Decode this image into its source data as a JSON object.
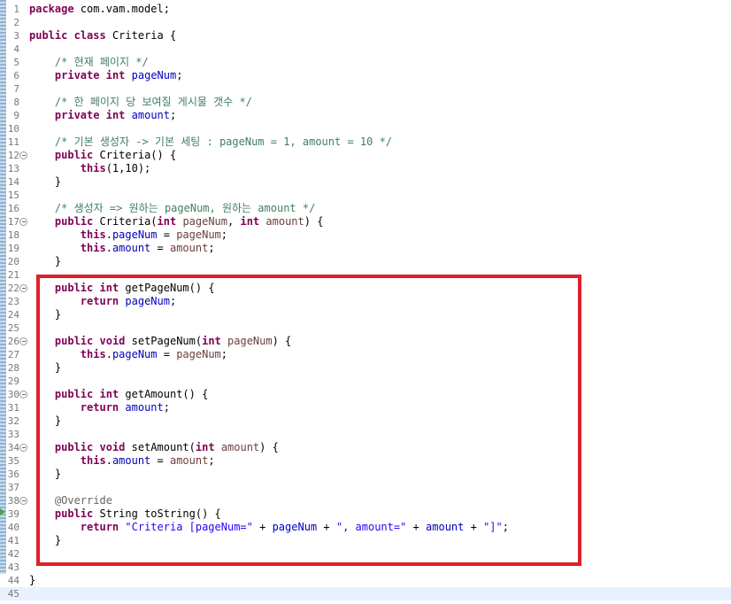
{
  "editor": {
    "lines": [
      {
        "n": "1",
        "tokens": [
          {
            "c": "kw",
            "t": "package"
          },
          {
            "c": "plain",
            "t": " com.vam.model;"
          }
        ]
      },
      {
        "n": "2",
        "tokens": []
      },
      {
        "n": "3",
        "tokens": [
          {
            "c": "kw",
            "t": "public"
          },
          {
            "c": "plain",
            "t": " "
          },
          {
            "c": "kw",
            "t": "class"
          },
          {
            "c": "plain",
            "t": " Criteria {"
          }
        ]
      },
      {
        "n": "4",
        "tokens": []
      },
      {
        "n": "5",
        "tokens": [
          {
            "c": "plain",
            "t": "    "
          },
          {
            "c": "comment",
            "t": "/* 현재 페이지 */"
          }
        ]
      },
      {
        "n": "6",
        "tokens": [
          {
            "c": "plain",
            "t": "    "
          },
          {
            "c": "kw",
            "t": "private"
          },
          {
            "c": "plain",
            "t": " "
          },
          {
            "c": "kw",
            "t": "int"
          },
          {
            "c": "plain",
            "t": " "
          },
          {
            "c": "field",
            "t": "pageNum"
          },
          {
            "c": "plain",
            "t": ";"
          }
        ]
      },
      {
        "n": "7",
        "tokens": []
      },
      {
        "n": "8",
        "tokens": [
          {
            "c": "plain",
            "t": "    "
          },
          {
            "c": "comment",
            "t": "/* 한 페이지 당 보여질 게시물 갯수 */"
          }
        ]
      },
      {
        "n": "9",
        "tokens": [
          {
            "c": "plain",
            "t": "    "
          },
          {
            "c": "kw",
            "t": "private"
          },
          {
            "c": "plain",
            "t": " "
          },
          {
            "c": "kw",
            "t": "int"
          },
          {
            "c": "plain",
            "t": " "
          },
          {
            "c": "field",
            "t": "amount"
          },
          {
            "c": "plain",
            "t": ";"
          }
        ]
      },
      {
        "n": "10",
        "tokens": []
      },
      {
        "n": "11",
        "tokens": [
          {
            "c": "plain",
            "t": "    "
          },
          {
            "c": "comment",
            "t": "/* 기본 생성자 -> 기본 세팅 : pageNum = 1, amount = 10 */"
          }
        ]
      },
      {
        "n": "12",
        "fold": true,
        "tokens": [
          {
            "c": "plain",
            "t": "    "
          },
          {
            "c": "kw",
            "t": "public"
          },
          {
            "c": "plain",
            "t": " Criteria() {"
          }
        ]
      },
      {
        "n": "13",
        "tokens": [
          {
            "c": "plain",
            "t": "        "
          },
          {
            "c": "kw",
            "t": "this"
          },
          {
            "c": "plain",
            "t": "(1,10);"
          }
        ]
      },
      {
        "n": "14",
        "tokens": [
          {
            "c": "plain",
            "t": "    }"
          }
        ]
      },
      {
        "n": "15",
        "tokens": []
      },
      {
        "n": "16",
        "tokens": [
          {
            "c": "plain",
            "t": "    "
          },
          {
            "c": "comment",
            "t": "/* 생성자 => 원하는 pageNum, 원하는 amount */"
          }
        ]
      },
      {
        "n": "17",
        "fold": true,
        "tokens": [
          {
            "c": "plain",
            "t": "    "
          },
          {
            "c": "kw",
            "t": "public"
          },
          {
            "c": "plain",
            "t": " Criteria("
          },
          {
            "c": "kw",
            "t": "int"
          },
          {
            "c": "plain",
            "t": " "
          },
          {
            "c": "param",
            "t": "pageNum"
          },
          {
            "c": "plain",
            "t": ", "
          },
          {
            "c": "kw",
            "t": "int"
          },
          {
            "c": "plain",
            "t": " "
          },
          {
            "c": "param",
            "t": "amount"
          },
          {
            "c": "plain",
            "t": ") {"
          }
        ]
      },
      {
        "n": "18",
        "tokens": [
          {
            "c": "plain",
            "t": "        "
          },
          {
            "c": "kw",
            "t": "this"
          },
          {
            "c": "plain",
            "t": "."
          },
          {
            "c": "field",
            "t": "pageNum"
          },
          {
            "c": "plain",
            "t": " = "
          },
          {
            "c": "param",
            "t": "pageNum"
          },
          {
            "c": "plain",
            "t": ";"
          }
        ]
      },
      {
        "n": "19",
        "tokens": [
          {
            "c": "plain",
            "t": "        "
          },
          {
            "c": "kw",
            "t": "this"
          },
          {
            "c": "plain",
            "t": "."
          },
          {
            "c": "field",
            "t": "amount"
          },
          {
            "c": "plain",
            "t": " = "
          },
          {
            "c": "param",
            "t": "amount"
          },
          {
            "c": "plain",
            "t": ";"
          }
        ]
      },
      {
        "n": "20",
        "tokens": [
          {
            "c": "plain",
            "t": "    }"
          }
        ]
      },
      {
        "n": "21",
        "tokens": []
      },
      {
        "n": "22",
        "fold": true,
        "tokens": [
          {
            "c": "plain",
            "t": "    "
          },
          {
            "c": "kw",
            "t": "public"
          },
          {
            "c": "plain",
            "t": " "
          },
          {
            "c": "kw",
            "t": "int"
          },
          {
            "c": "plain",
            "t": " getPageNum() {"
          }
        ]
      },
      {
        "n": "23",
        "tokens": [
          {
            "c": "plain",
            "t": "        "
          },
          {
            "c": "kw",
            "t": "return"
          },
          {
            "c": "plain",
            "t": " "
          },
          {
            "c": "field",
            "t": "pageNum"
          },
          {
            "c": "plain",
            "t": ";"
          }
        ]
      },
      {
        "n": "24",
        "tokens": [
          {
            "c": "plain",
            "t": "    }"
          }
        ]
      },
      {
        "n": "25",
        "tokens": []
      },
      {
        "n": "26",
        "fold": true,
        "tokens": [
          {
            "c": "plain",
            "t": "    "
          },
          {
            "c": "kw",
            "t": "public"
          },
          {
            "c": "plain",
            "t": " "
          },
          {
            "c": "kw",
            "t": "void"
          },
          {
            "c": "plain",
            "t": " setPageNum("
          },
          {
            "c": "kw",
            "t": "int"
          },
          {
            "c": "plain",
            "t": " "
          },
          {
            "c": "param",
            "t": "pageNum"
          },
          {
            "c": "plain",
            "t": ") {"
          }
        ]
      },
      {
        "n": "27",
        "tokens": [
          {
            "c": "plain",
            "t": "        "
          },
          {
            "c": "kw",
            "t": "this"
          },
          {
            "c": "plain",
            "t": "."
          },
          {
            "c": "field",
            "t": "pageNum"
          },
          {
            "c": "plain",
            "t": " = "
          },
          {
            "c": "param",
            "t": "pageNum"
          },
          {
            "c": "plain",
            "t": ";"
          }
        ]
      },
      {
        "n": "28",
        "tokens": [
          {
            "c": "plain",
            "t": "    }"
          }
        ]
      },
      {
        "n": "29",
        "tokens": []
      },
      {
        "n": "30",
        "fold": true,
        "tokens": [
          {
            "c": "plain",
            "t": "    "
          },
          {
            "c": "kw",
            "t": "public"
          },
          {
            "c": "plain",
            "t": " "
          },
          {
            "c": "kw",
            "t": "int"
          },
          {
            "c": "plain",
            "t": " getAmount() {"
          }
        ]
      },
      {
        "n": "31",
        "tokens": [
          {
            "c": "plain",
            "t": "        "
          },
          {
            "c": "kw",
            "t": "return"
          },
          {
            "c": "plain",
            "t": " "
          },
          {
            "c": "field",
            "t": "amount"
          },
          {
            "c": "plain",
            "t": ";"
          }
        ]
      },
      {
        "n": "32",
        "tokens": [
          {
            "c": "plain",
            "t": "    }"
          }
        ]
      },
      {
        "n": "33",
        "tokens": []
      },
      {
        "n": "34",
        "fold": true,
        "tokens": [
          {
            "c": "plain",
            "t": "    "
          },
          {
            "c": "kw",
            "t": "public"
          },
          {
            "c": "plain",
            "t": " "
          },
          {
            "c": "kw",
            "t": "void"
          },
          {
            "c": "plain",
            "t": " setAmount("
          },
          {
            "c": "kw",
            "t": "int"
          },
          {
            "c": "plain",
            "t": " "
          },
          {
            "c": "param",
            "t": "amount"
          },
          {
            "c": "plain",
            "t": ") {"
          }
        ]
      },
      {
        "n": "35",
        "tokens": [
          {
            "c": "plain",
            "t": "        "
          },
          {
            "c": "kw",
            "t": "this"
          },
          {
            "c": "plain",
            "t": "."
          },
          {
            "c": "field",
            "t": "amount"
          },
          {
            "c": "plain",
            "t": " = "
          },
          {
            "c": "param",
            "t": "amount"
          },
          {
            "c": "plain",
            "t": ";"
          }
        ]
      },
      {
        "n": "36",
        "tokens": [
          {
            "c": "plain",
            "t": "    }"
          }
        ]
      },
      {
        "n": "37",
        "tokens": []
      },
      {
        "n": "38",
        "fold": true,
        "tokens": [
          {
            "c": "plain",
            "t": "    "
          },
          {
            "c": "ann",
            "t": "@Override"
          }
        ]
      },
      {
        "n": "39",
        "tokens": [
          {
            "c": "plain",
            "t": "    "
          },
          {
            "c": "kw",
            "t": "public"
          },
          {
            "c": "plain",
            "t": " String toString() {"
          }
        ]
      },
      {
        "n": "40",
        "tokens": [
          {
            "c": "plain",
            "t": "        "
          },
          {
            "c": "kw",
            "t": "return"
          },
          {
            "c": "plain",
            "t": " "
          },
          {
            "c": "string",
            "t": "\"Criteria [pageNum=\""
          },
          {
            "c": "plain",
            "t": " + "
          },
          {
            "c": "field",
            "t": "pageNum"
          },
          {
            "c": "plain",
            "t": " + "
          },
          {
            "c": "string",
            "t": "\", amount=\""
          },
          {
            "c": "plain",
            "t": " + "
          },
          {
            "c": "field",
            "t": "amount"
          },
          {
            "c": "plain",
            "t": " + "
          },
          {
            "c": "string",
            "t": "\"]\""
          },
          {
            "c": "plain",
            "t": ";"
          }
        ]
      },
      {
        "n": "41",
        "tokens": [
          {
            "c": "plain",
            "t": "    }"
          }
        ]
      },
      {
        "n": "42",
        "tokens": []
      },
      {
        "n": "43",
        "tokens": []
      },
      {
        "n": "44",
        "tokens": [
          {
            "c": "plain",
            "t": "}"
          }
        ]
      },
      {
        "n": "45",
        "current": true,
        "tokens": []
      }
    ]
  },
  "annotation": {
    "color": "#e0202a"
  }
}
